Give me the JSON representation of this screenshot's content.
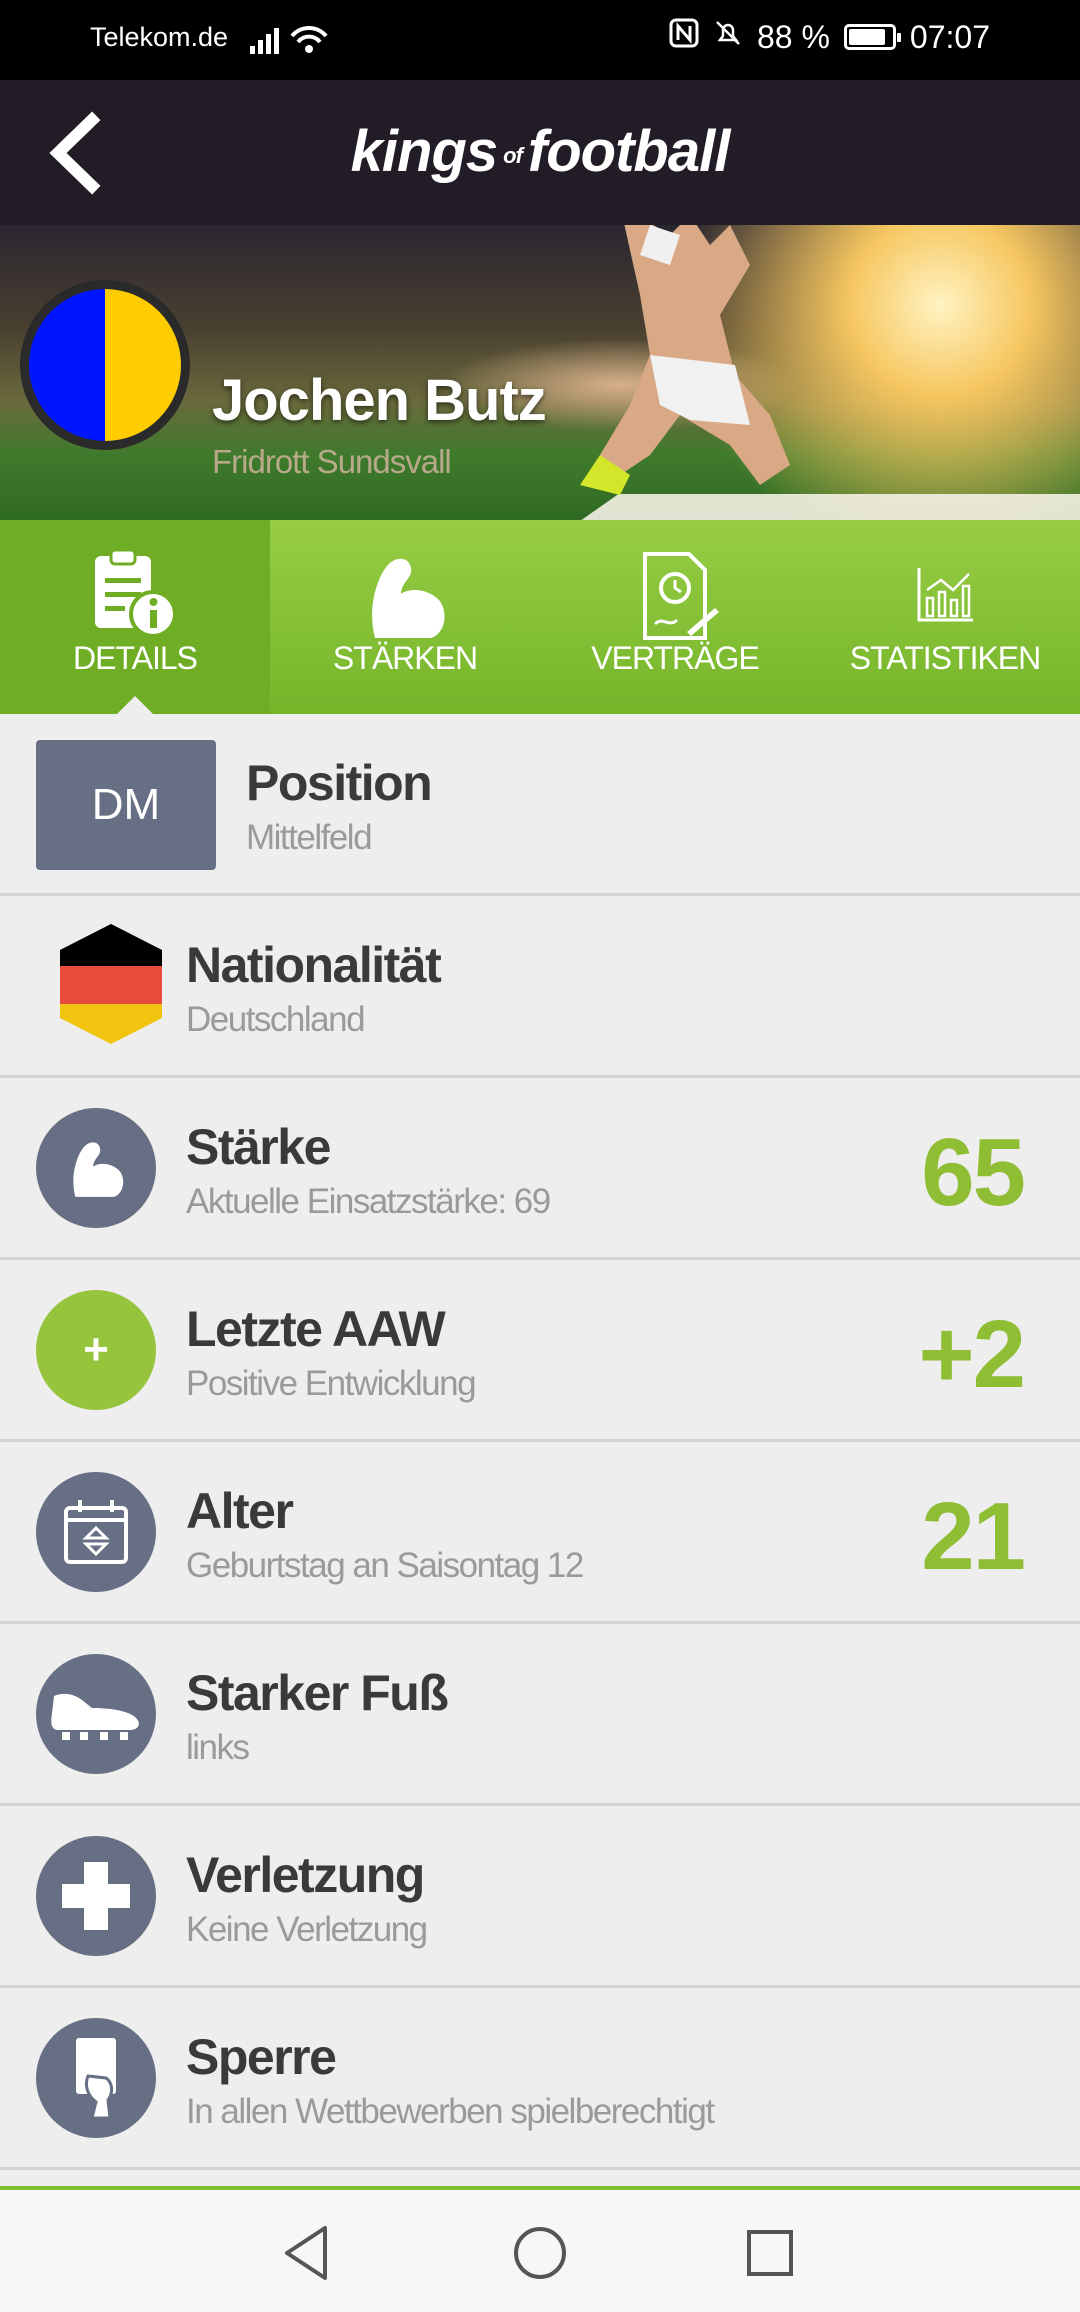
{
  "status_bar": {
    "carrier": "Telekom.de",
    "battery_percent": "88 %",
    "time": "07:07",
    "icons": [
      "signal-icon",
      "wifi-icon",
      "nfc-icon",
      "mute-icon",
      "battery-icon"
    ]
  },
  "header": {
    "logo_kings": "kings",
    "logo_of": "of",
    "logo_football": "football",
    "back_icon": "chevron-left-icon"
  },
  "player": {
    "name": "Jochen Butz",
    "club": "Fridrott Sundsvall",
    "club_colors": [
      "#0015ff",
      "#ffcc00"
    ]
  },
  "tabs": [
    {
      "label": "DETAILS",
      "icon": "clipboard-info-icon",
      "active": true
    },
    {
      "label": "STÄRKEN",
      "icon": "flexed-arm-icon",
      "active": false
    },
    {
      "label": "VERTRÄGE",
      "icon": "contract-icon",
      "active": false
    },
    {
      "label": "STATISTIKEN",
      "icon": "bar-chart-icon",
      "active": false
    }
  ],
  "details": {
    "position": {
      "badge": "DM",
      "title": "Position",
      "subtitle": "Mittelfeld"
    },
    "nationality": {
      "title": "Nationalität",
      "subtitle": "Deutschland",
      "flag": [
        "#000000",
        "#e84c3d",
        "#f1c40f"
      ]
    },
    "strength": {
      "title": "Stärke",
      "subtitle": "Aktuelle Einsatzstärke: 69",
      "value": "65"
    },
    "last_aaw": {
      "title": "Letzte AAW",
      "subtitle": "Positive Entwicklung",
      "value": "+2",
      "icon_symbol": "+"
    },
    "age": {
      "title": "Alter",
      "subtitle": "Geburtstag an Saisontag 12",
      "value": "21"
    },
    "strong_foot": {
      "title": "Starker Fuß",
      "subtitle": "links"
    },
    "injury": {
      "title": "Verletzung",
      "subtitle": "Keine Verletzung"
    },
    "suspension": {
      "title": "Sperre",
      "subtitle": "In allen Wettbewerben spielberechtigt"
    }
  },
  "colors": {
    "accent_green": "#8fbe34",
    "header_dark": "#221c27",
    "icon_grey": "#676f84"
  }
}
